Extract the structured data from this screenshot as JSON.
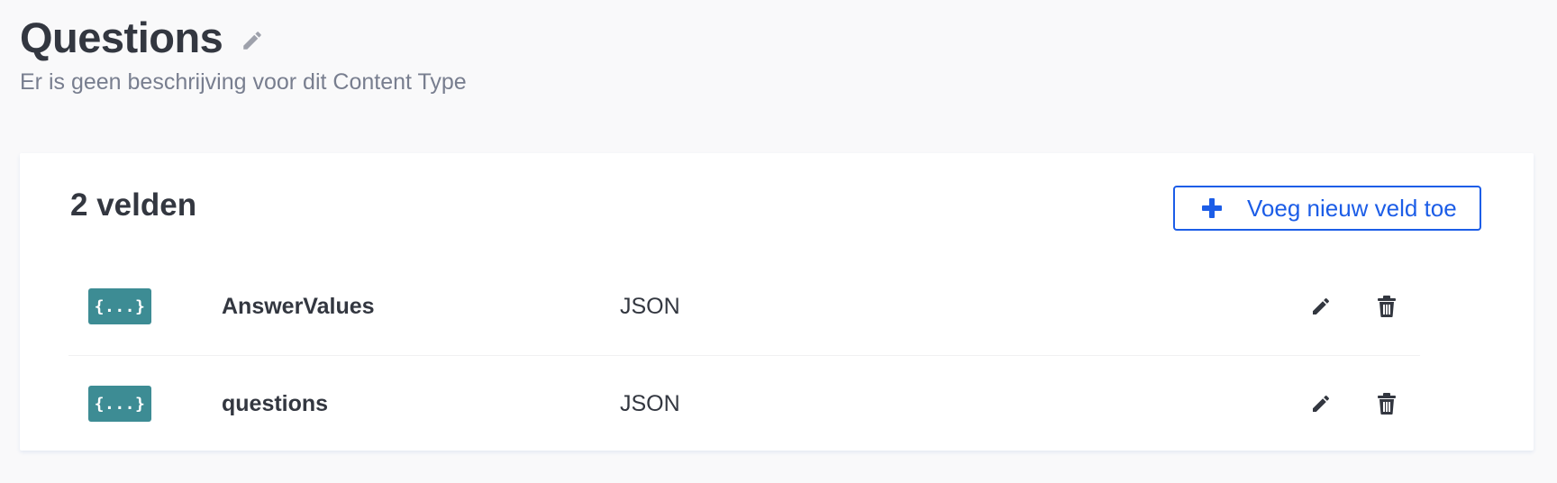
{
  "header": {
    "title": "Questions",
    "edit_icon": "pencil-icon",
    "subtitle": "Er is geen beschrijving voor dit Content Type"
  },
  "fields_panel": {
    "count_label": "2 velden",
    "add_button": {
      "icon": "plus-icon",
      "label": "Voeg nieuw veld toe"
    },
    "fields": [
      {
        "badge": "{...}",
        "name": "AnswerValues",
        "type": "JSON",
        "edit_icon": "pencil-icon",
        "delete_icon": "trash-icon"
      },
      {
        "badge": "{...}",
        "name": "questions",
        "type": "JSON",
        "edit_icon": "pencil-icon",
        "delete_icon": "trash-icon"
      }
    ]
  },
  "colors": {
    "background": "#f9f9fa",
    "text": "#333740",
    "subtitle": "#787e8f",
    "accent": "#1c5de7",
    "json_badge": "#3d8c94"
  }
}
